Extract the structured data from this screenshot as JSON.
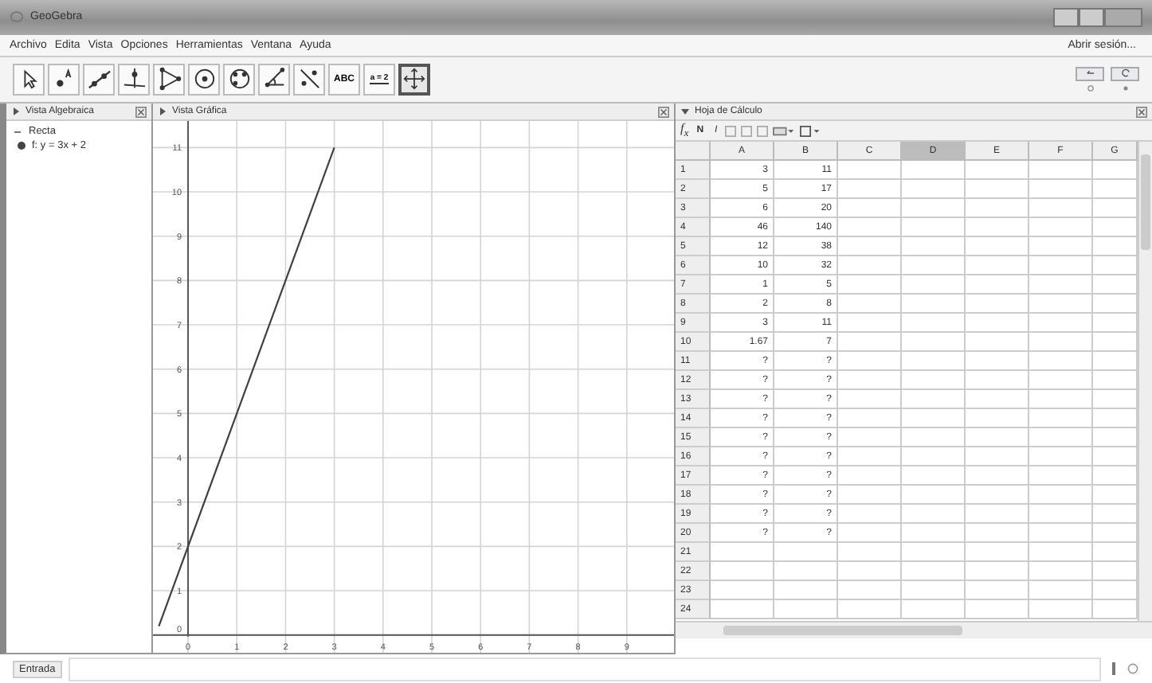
{
  "window": {
    "title": "GeoGebra"
  },
  "menu": [
    "Archivo",
    "Edita",
    "Vista",
    "Opciones",
    "Herramientas",
    "Ventana",
    "Ayuda"
  ],
  "session_link": "Abrir sesión...",
  "toolbar": [
    {
      "kind": "pointer",
      "selected": false
    },
    {
      "kind": "point",
      "selected": false
    },
    {
      "kind": "line",
      "selected": false
    },
    {
      "kind": "perpendicular",
      "selected": false
    },
    {
      "kind": "polygon",
      "selected": false
    },
    {
      "kind": "circle",
      "selected": false
    },
    {
      "kind": "conic",
      "selected": false
    },
    {
      "kind": "angle",
      "selected": false
    },
    {
      "kind": "reflect",
      "selected": false
    },
    {
      "kind": "text",
      "label": "ABC",
      "selected": false
    },
    {
      "kind": "slider",
      "label": "a = 2",
      "selected": false
    },
    {
      "kind": "move-view",
      "selected": true
    }
  ],
  "algebra_view": {
    "title": "Vista Algebraica",
    "expanded": false,
    "groups": [
      {
        "label": "Recta",
        "expanded": true,
        "children": [
          {
            "text": "f: y = 3x + 2",
            "visible": true
          }
        ]
      }
    ]
  },
  "graphics_view": {
    "title": "Vista Gráfica",
    "expanded": false,
    "chart_data": {
      "type": "line",
      "x": [
        -0.6,
        3
      ],
      "series": [
        {
          "color": "#404040",
          "values": [
            0.2,
            11
          ]
        }
      ],
      "xlim": [
        -0.72,
        10
      ],
      "ylim": [
        -0.4,
        11.6
      ],
      "xticks": [
        0,
        1,
        2,
        3,
        4,
        5,
        6,
        7,
        8,
        9
      ],
      "yticks": [
        0,
        1,
        2,
        3,
        4,
        5,
        6,
        7,
        8,
        9,
        10,
        11
      ],
      "grid": true
    }
  },
  "spreadsheet": {
    "title": "Hoja de Cálculo",
    "expanded": true,
    "formula": "f$_{x}$",
    "bold": "N",
    "italic": "I",
    "columns": [
      {
        "label": "A",
        "selected": false
      },
      {
        "label": "B",
        "selected": false
      },
      {
        "label": "C",
        "selected": false
      },
      {
        "label": "D",
        "selected": true
      },
      {
        "label": "E",
        "selected": false
      },
      {
        "label": "F",
        "selected": false
      },
      {
        "label": "G",
        "selected": false
      }
    ],
    "rows": [
      {
        "label": "1",
        "cells": [
          "3",
          "11"
        ]
      },
      {
        "label": "2",
        "cells": [
          "5",
          "17"
        ]
      },
      {
        "label": "3",
        "cells": [
          "6",
          "20"
        ]
      },
      {
        "label": "4",
        "cells": [
          "46",
          "140"
        ]
      },
      {
        "label": "5",
        "cells": [
          "12",
          "38"
        ]
      },
      {
        "label": "6",
        "cells": [
          "10",
          "32"
        ]
      },
      {
        "label": "7",
        "cells": [
          "1",
          "5"
        ]
      },
      {
        "label": "8",
        "cells": [
          "2",
          "8"
        ]
      },
      {
        "label": "9",
        "cells": [
          "3",
          "11"
        ]
      },
      {
        "label": "10",
        "cells": [
          "1.67",
          "7"
        ]
      },
      {
        "label": "11",
        "cells": [
          "?",
          "?"
        ]
      },
      {
        "label": "12",
        "cells": [
          "?",
          "?"
        ]
      },
      {
        "label": "13",
        "cells": [
          "?",
          "?"
        ]
      },
      {
        "label": "14",
        "cells": [
          "?",
          "?"
        ]
      },
      {
        "label": "15",
        "cells": [
          "?",
          "?"
        ]
      },
      {
        "label": "16",
        "cells": [
          "?",
          "?"
        ]
      },
      {
        "label": "17",
        "cells": [
          "?",
          "?"
        ]
      },
      {
        "label": "18",
        "cells": [
          "?",
          "?"
        ]
      },
      {
        "label": "19",
        "cells": [
          "?",
          "?"
        ]
      },
      {
        "label": "20",
        "cells": [
          "?",
          "?"
        ]
      },
      {
        "label": "21",
        "cells": []
      },
      {
        "label": "22",
        "cells": []
      },
      {
        "label": "23",
        "cells": []
      },
      {
        "label": "24",
        "cells": []
      }
    ]
  },
  "input_bar": {
    "label": "Entrada"
  }
}
